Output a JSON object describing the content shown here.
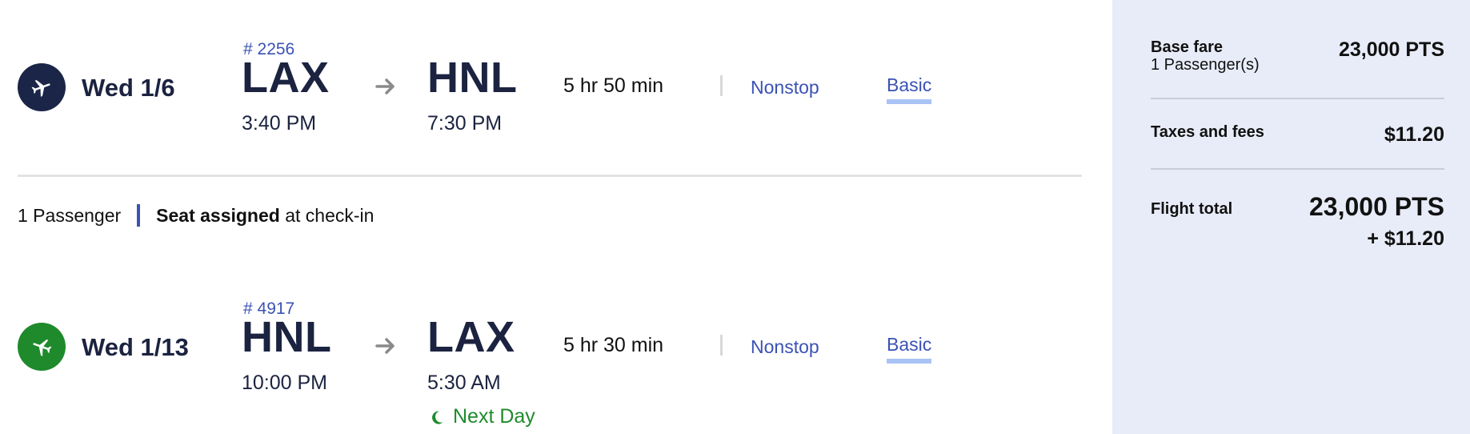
{
  "itinerary": {
    "outbound": {
      "date": "Wed 1/6",
      "flight_number": "# 2256",
      "origin": "LAX",
      "destination": "HNL",
      "depart_time": "3:40 PM",
      "arrive_time": "7:30 PM",
      "duration": "5 hr 50 min",
      "stops": "Nonstop",
      "fare_class": "Basic",
      "icon": "plane-departure-icon",
      "icon_color": "#1a2548"
    },
    "passenger_info": {
      "passengers": "1 Passenger",
      "seat_bold": "Seat assigned",
      "seat_rest": " at check-in"
    },
    "return": {
      "date": "Wed 1/13",
      "flight_number": "# 4917",
      "origin": "HNL",
      "destination": "LAX",
      "depart_time": "10:00 PM",
      "arrive_time": "5:30 AM",
      "arrival_note": "Next Day",
      "duration": "5 hr 30 min",
      "stops": "Nonstop",
      "fare_class": "Basic",
      "icon": "plane-return-icon",
      "icon_color": "#1f8a2c"
    }
  },
  "summary": {
    "base_fare_label": "Base fare",
    "base_fare_sub": "1 Passenger(s)",
    "base_fare_value": "23,000 PTS",
    "taxes_label": "Taxes and fees",
    "taxes_value": "$11.20",
    "total_label": "Flight total",
    "total_points": "23,000 PTS",
    "total_cash": "+ $11.20"
  },
  "colors": {
    "navy": "#1b2340",
    "link_blue": "#3a52b5",
    "fare_underline": "#a9c3f5",
    "green": "#1f8a2c",
    "summary_bg": "#e8ecf8"
  }
}
